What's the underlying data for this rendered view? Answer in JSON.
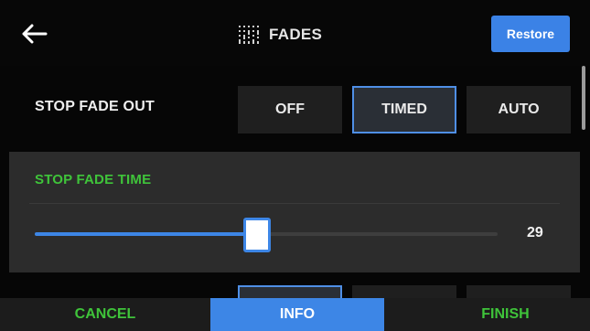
{
  "header": {
    "back_icon": "arrow-left-icon",
    "title_icon": "faders-icon",
    "title": "FADES",
    "restore_label": "Restore"
  },
  "stop_fade_out": {
    "label": "STOP FADE OUT",
    "options": [
      "OFF",
      "TIMED",
      "AUTO"
    ],
    "selected": "TIMED"
  },
  "stop_fade_time": {
    "label": "STOP FADE TIME",
    "value": "29",
    "slider_fraction": 0.48
  },
  "footer": {
    "cancel_label": "CANCEL",
    "info_label": "INFO",
    "finish_label": "FINISH"
  },
  "colors": {
    "accent_blue": "#3d86e6",
    "label_green": "#3fc43a",
    "panel": "#2c2c2c",
    "background": "#060606"
  }
}
